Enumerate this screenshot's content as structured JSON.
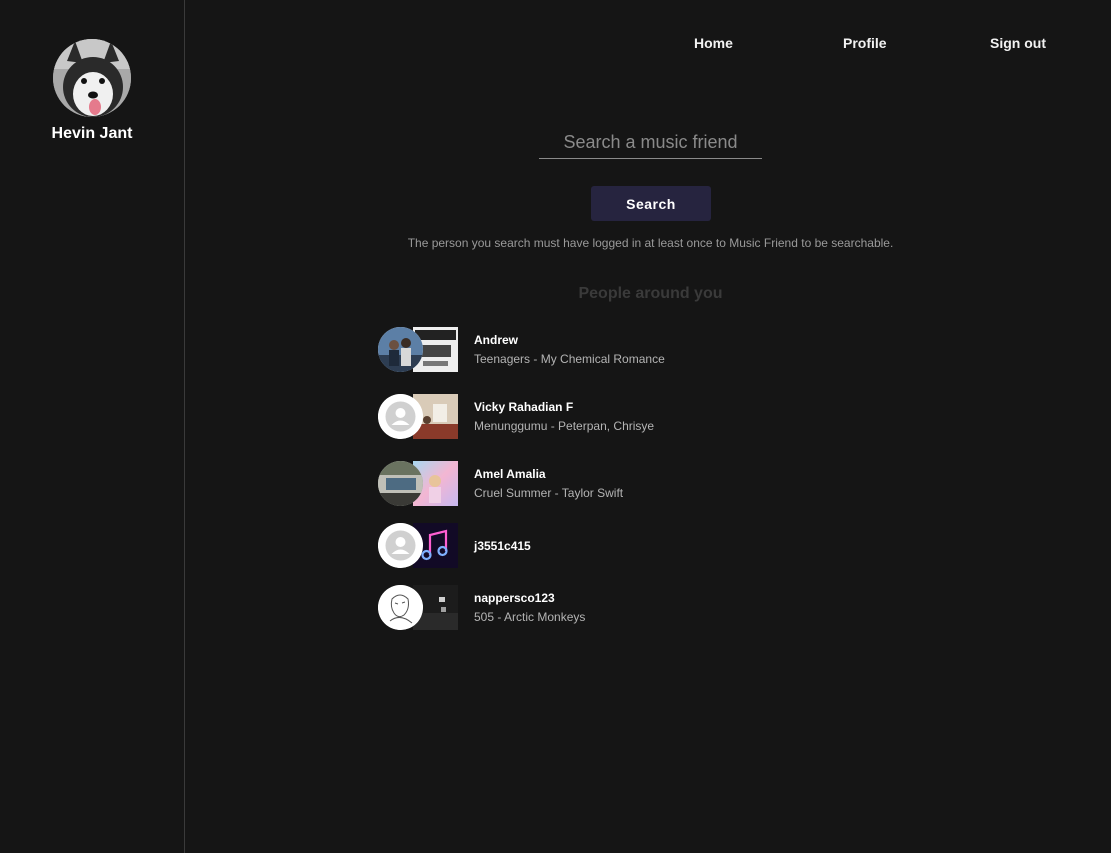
{
  "user": {
    "name": "Hevin Jant"
  },
  "nav": {
    "home": "Home",
    "profile": "Profile",
    "signout": "Sign out"
  },
  "search": {
    "placeholder": "Search a music friend",
    "button_label": "Search",
    "helper": "The person you search must have logged in at least once to Music Friend to be searchable."
  },
  "people": {
    "title": "People around you",
    "items": [
      {
        "name": "Andrew",
        "song": "Teenagers - My Chemical Romance",
        "avatar": "photo-avatar",
        "art": "album-art"
      },
      {
        "name": "Vicky Rahadian F",
        "song": "Menunggumu - Peterpan, Chrisye",
        "avatar": "default-user-icon",
        "art": "album-art"
      },
      {
        "name": "Amel Amalia",
        "song": "Cruel Summer - Taylor Swift",
        "avatar": "photo-avatar",
        "art": "album-art"
      },
      {
        "name": "j3551c415",
        "song": "",
        "avatar": "default-user-icon",
        "art": "music-note-icon"
      },
      {
        "name": "nappersco123",
        "song": "505 - Arctic Monkeys",
        "avatar": "sketch-avatar",
        "art": "album-art"
      }
    ]
  },
  "colors": {
    "background": "#151515",
    "button": "#26243f",
    "muted_text": "#b4b4b4",
    "section_title": "#3a3a3a"
  }
}
